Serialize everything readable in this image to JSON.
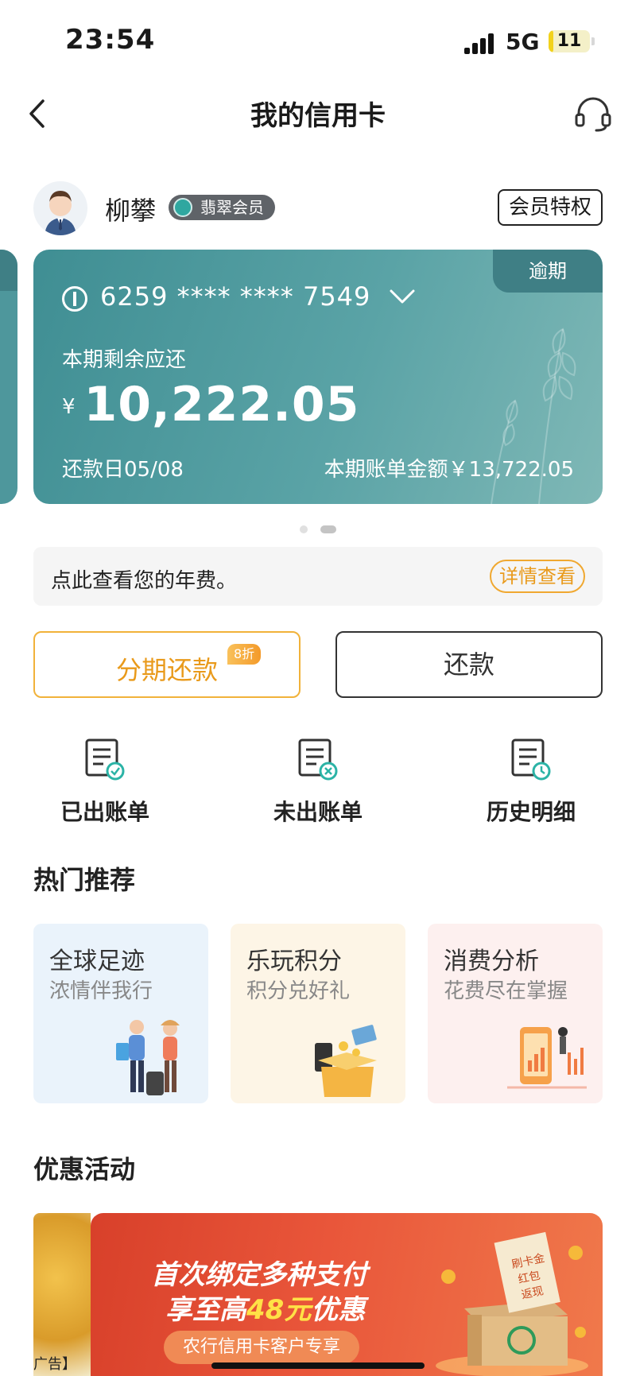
{
  "status_bar": {
    "time": "23:54",
    "network": "5G",
    "battery": "11",
    "battery_level": 0.11
  },
  "nav": {
    "title": "我的信用卡"
  },
  "profile": {
    "name": "柳攀",
    "member_level": "翡翠会员",
    "privilege_label": "会员特权"
  },
  "card": {
    "overdue_label": "逾期",
    "number": "6259 **** **** 7549",
    "remaining_label": "本期剩余应还",
    "currency": "¥",
    "remaining_amount": "10,222.05",
    "due_date": "还款日05/08",
    "bill_amount": "本期账单金额￥13,722.05",
    "carousel_count": 2,
    "carousel_active": 2
  },
  "annual_fee": {
    "text": "点此查看您的年费。",
    "detail_label": "详情查看"
  },
  "actions": {
    "installment_label": "分期还款",
    "installment_tag": "8折",
    "repay_label": "还款"
  },
  "shortcuts": [
    {
      "label": "已出账单",
      "icon": "bill-check-icon"
    },
    {
      "label": "未出账单",
      "icon": "bill-pending-icon"
    },
    {
      "label": "历史明细",
      "icon": "bill-history-icon"
    }
  ],
  "recommend": {
    "title": "热门推荐",
    "cards": [
      {
        "title": "全球足迹",
        "subtitle": "浓情伴我行",
        "bg": "#eaf3fb"
      },
      {
        "title": "乐玩积分",
        "subtitle": "积分兑好礼",
        "bg": "#fdf5e6"
      },
      {
        "title": "消费分析",
        "subtitle": "花费尽在掌握",
        "bg": "#fdf0ef"
      }
    ]
  },
  "promotions": {
    "title": "优惠活动",
    "ad_label": "广告】",
    "banner": {
      "line1": "首次绑定多种支付",
      "line2_prefix": "享至高",
      "line2_highlight": "48元",
      "line2_suffix": "优惠",
      "pill": "农行信用卡客户专享",
      "box_text": [
        "刷卡金",
        "红包",
        "返现"
      ]
    }
  },
  "colors": {
    "card": "#4e979c",
    "accent": "#f0a830",
    "promo": "#e14a30"
  }
}
